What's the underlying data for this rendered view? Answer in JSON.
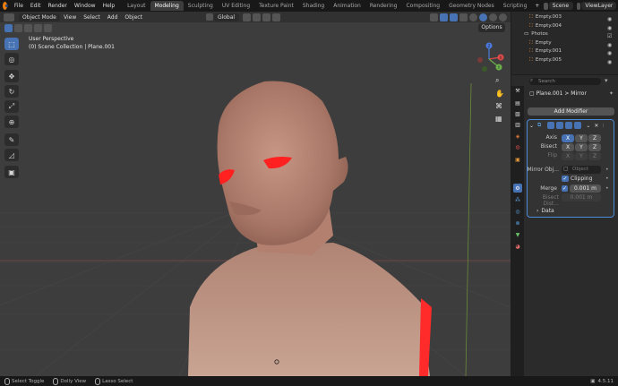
{
  "topbar": {
    "menus": [
      "File",
      "Edit",
      "Render",
      "Window",
      "Help"
    ],
    "workspaces": [
      "Layout",
      "Modeling",
      "Sculpting",
      "UV Editing",
      "Texture Paint",
      "Shading",
      "Animation",
      "Rendering",
      "Compositing",
      "Geometry Nodes",
      "Scripting"
    ],
    "active_workspace": "Modeling",
    "add_tab": "+",
    "scene": "Scene",
    "view_layer": "ViewLayer"
  },
  "viewport_header": {
    "mode": "Object Mode",
    "menus": [
      "View",
      "Select",
      "Add",
      "Object"
    ],
    "transform_orientation": "Global",
    "options": "Options"
  },
  "viewport": {
    "perspective": "User Perspective",
    "collection_info": "(0) Scene Collection | Plane.001",
    "gizmo_labels": {
      "x": "X",
      "y": "Y",
      "z": "Z"
    }
  },
  "outliner": {
    "rows": [
      {
        "label": "Empty.003",
        "type": "empty"
      },
      {
        "label": "Empty.004",
        "type": "empty"
      },
      {
        "label": "Photos",
        "type": "collection"
      },
      {
        "label": "Empty",
        "type": "empty"
      },
      {
        "label": "Empty.001",
        "type": "empty"
      },
      {
        "label": "Empty.005",
        "type": "empty"
      }
    ]
  },
  "properties": {
    "search_placeholder": "Search",
    "breadcrumb_object": "Plane.001",
    "breadcrumb_modifier": "Mirror",
    "add_modifier": "Add Modifier",
    "axis_label": "Axis",
    "bisect_label": "Bisect",
    "flip_label": "Flip",
    "axes": [
      "X",
      "Y",
      "Z"
    ],
    "mirror_object_label": "Mirror Obj...",
    "mirror_object_placeholder": "Object",
    "clipping_label": "Clipping",
    "merge_label": "Merge",
    "merge_value": "0.001 m",
    "bisect_distance_label": "Bisect Dist...",
    "bisect_distance_value": "0.001 m",
    "data_label": "Data"
  },
  "statusbar": {
    "select_toggle": "Select Toggle",
    "dolly_view": "Dolly View",
    "lasso_select": "Lasso Select",
    "version": "4.5.11"
  },
  "colors": {
    "accent": "#4772b3",
    "skin": "#b98a78",
    "eye_red": "#ff2020",
    "background_viewport": "#3d3d3d"
  }
}
